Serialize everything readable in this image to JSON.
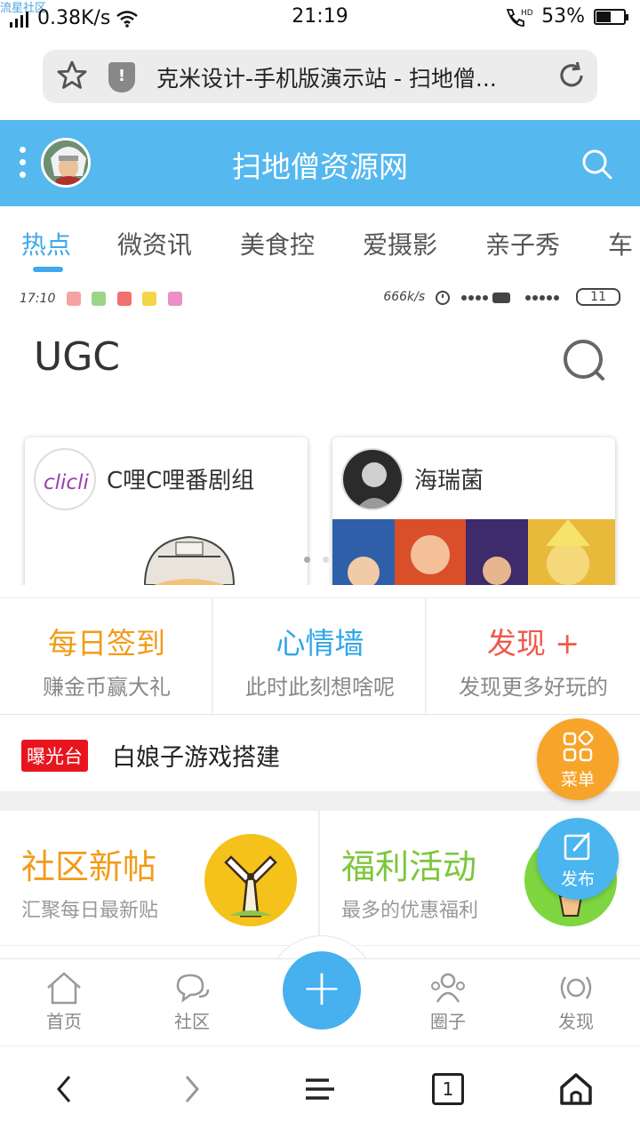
{
  "status_bar": {
    "watermark": "流星社区",
    "network_speed": "0.38K/s",
    "time": "21:19",
    "battery": "53%",
    "battery_level": 0.53
  },
  "browser": {
    "url_title": "克米设计-手机版演示站 - 扫地僧...",
    "shield_glyph": "!"
  },
  "header": {
    "title": "扫地僧资源网"
  },
  "tabs": [
    {
      "label": "热点",
      "active": true
    },
    {
      "label": "微资讯",
      "active": false
    },
    {
      "label": "美食控",
      "active": false
    },
    {
      "label": "爱摄影",
      "active": false
    },
    {
      "label": "亲子秀",
      "active": false
    },
    {
      "label": "车",
      "active": false
    }
  ],
  "banner": {
    "mini_time": "17:10",
    "mini_speed": "666k/s",
    "mini_battery": "11",
    "heading": "UGC",
    "cards": [
      {
        "name": "C哩C哩番剧组",
        "logo_text": "clicli"
      },
      {
        "name": "海瑞菌"
      }
    ]
  },
  "features": [
    {
      "title": "每日签到",
      "subtitle": "赚金币赢大礼",
      "color": "#f29b17"
    },
    {
      "title": "心情墙",
      "subtitle": "此时此刻想啥呢",
      "color": "#2fa6e8"
    },
    {
      "title": "发现 +",
      "subtitle": "发现更多好玩的",
      "color": "#f0584a"
    }
  ],
  "exposure": {
    "badge": "曝光台",
    "text": "白娘子游戏搭建"
  },
  "blocks": [
    {
      "title": "社区新帖",
      "subtitle": "汇聚每日最新贴",
      "color": "#f29b17",
      "icon_bg": "#f5c21b"
    },
    {
      "title": "福利活动",
      "subtitle": "最多的优惠福利",
      "color": "#7dc63a",
      "icon_bg": "#7ed640"
    }
  ],
  "fabs": {
    "menu": "菜单",
    "publish": "发布",
    "menu_color": "#f7a42a",
    "publish_color": "#4ab5ef"
  },
  "bottom_nav": [
    {
      "label": "首页",
      "icon": "home-icon"
    },
    {
      "label": "社区",
      "icon": "chat-icon"
    },
    {
      "label": "圈子",
      "icon": "group-icon"
    },
    {
      "label": "发现",
      "icon": "broadcast-icon"
    }
  ],
  "center_button": "+",
  "system_nav": {
    "tab_count": "1"
  }
}
